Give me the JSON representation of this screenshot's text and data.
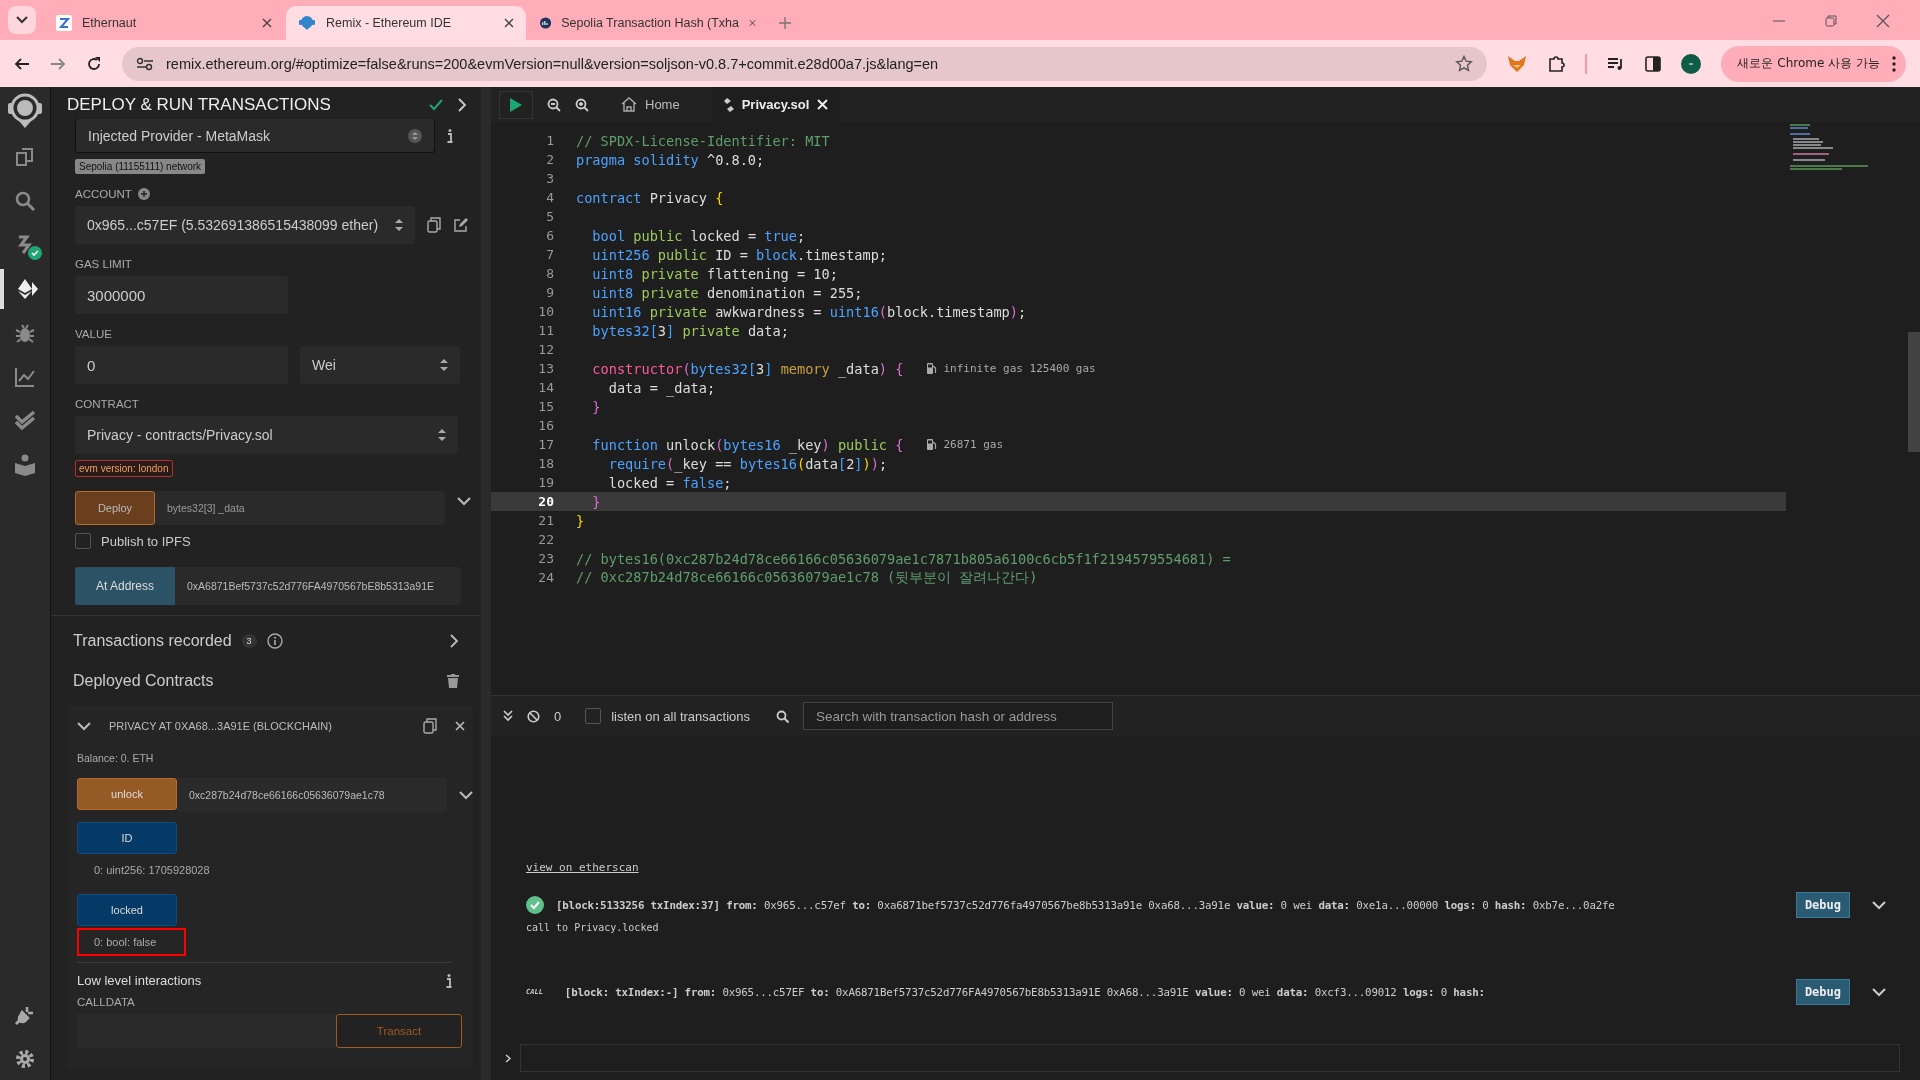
{
  "browser": {
    "tabs": [
      {
        "title": "Ethernaut",
        "kind": "z",
        "selected": false
      },
      {
        "title": "Remix - Ethereum IDE",
        "kind": "remix",
        "selected": true
      },
      {
        "title": "Sepolia Transaction Hash (Txha",
        "kind": "scan",
        "selected": false
      }
    ],
    "address": "remix.ethereum.org/#optimize=false&runs=200&evmVersion=null&version=soljson-v0.8.7+commit.e28d00a7.js&lang=en",
    "update_button": "새로운 Chrome 사용 가능"
  },
  "icon_bar": [
    {
      "kind": "files",
      "selected": false,
      "badge": false
    },
    {
      "kind": "search",
      "selected": false,
      "badge": false
    },
    {
      "kind": "compiler",
      "selected": false,
      "badge": true
    },
    {
      "kind": "deploy",
      "selected": true,
      "badge": false
    },
    {
      "kind": "debug",
      "selected": false,
      "badge": false
    },
    {
      "kind": "chart",
      "selected": false,
      "badge": false
    },
    {
      "kind": "tests",
      "selected": false,
      "badge": false
    },
    {
      "kind": "learn",
      "selected": false,
      "badge": false
    }
  ],
  "panel": {
    "title": "DEPLOY & RUN TRANSACTIONS",
    "environment": "Injected Provider - MetaMask",
    "network": "Sepolia (11155111) network",
    "account_label": "ACCOUNT",
    "account": "0x965...c57EF (5.532691386515438099 ether)",
    "gas_limit_label": "GAS LIMIT",
    "gas_limit": "3000000",
    "value_label": "VALUE",
    "value": "0",
    "unit": "Wei",
    "contract_label": "CONTRACT",
    "contract": "Privacy - contracts/Privacy.sol",
    "evm_badge": "evm version: london",
    "deploy_button": "Deploy",
    "deploy_placeholder": "bytes32[3] _data",
    "publish": {
      "label": "Publish to IPFS",
      "checked": false
    },
    "at_address_button": "At Address",
    "at_address_value": "0xA6871Bef5737c52d776FA4970567bE8b5313a91E",
    "recorded": {
      "label": "Transactions recorded",
      "count": "3"
    },
    "deployed_title": "Deployed Contracts",
    "instance": {
      "title": "PRIVACY AT 0XA68...3A91E (BLOCKCHAIN)",
      "expanded": true,
      "balance": "Balance: 0. ETH",
      "functions": [
        {
          "kind": "transact",
          "name": "unlock",
          "value": "0xc287b24d78ce66166c05636079ae1c78",
          "highlighted": false
        },
        {
          "kind": "call",
          "name": "ID",
          "output": "0: uint256: 1705928028",
          "highlighted": false
        },
        {
          "kind": "call",
          "name": "locked",
          "output": "0: bool: false",
          "highlighted": true
        }
      ],
      "low_level": {
        "title": "Low level interactions",
        "calldata_label": "CALLDATA",
        "button": "Transact"
      }
    }
  },
  "editor": {
    "tabs": [
      {
        "label": "Home",
        "kind": "home",
        "selected": false
      },
      {
        "label": "Privacy.sol",
        "kind": "file",
        "selected": true
      }
    ],
    "lines": [
      {
        "number": "1",
        "selected": false,
        "tokens": [
          {
            "text": "// SPDX-License-Identifier: MIT",
            "kind": "comment"
          }
        ]
      },
      {
        "number": "2",
        "selected": false,
        "tokens": [
          {
            "text": "pragma solidity",
            "kind": "keyword"
          },
          {
            "text": " ^0.8.0;",
            "kind": "plain"
          }
        ]
      },
      {
        "number": "3",
        "selected": false
      },
      {
        "number": "4",
        "selected": false,
        "tokens": [
          {
            "text": "contract",
            "kind": "keyword"
          },
          {
            "text": " Privacy ",
            "kind": "plain"
          },
          {
            "text": "{",
            "kind": "brace1"
          }
        ]
      },
      {
        "number": "5",
        "selected": false
      },
      {
        "number": "6",
        "selected": false,
        "tokens": [
          {
            "text": "  bool",
            "kind": "keyword"
          },
          {
            "text": " public",
            "kind": "modifier"
          },
          {
            "text": " locked = ",
            "kind": "plain"
          },
          {
            "text": "true",
            "kind": "keyword"
          },
          {
            "text": ";",
            "kind": "plain"
          }
        ]
      },
      {
        "number": "7",
        "selected": false,
        "tokens": [
          {
            "text": "  uint256",
            "kind": "keyword"
          },
          {
            "text": " public",
            "kind": "modifier"
          },
          {
            "text": " ID = ",
            "kind": "plain"
          },
          {
            "text": "block",
            "kind": "keyword"
          },
          {
            "text": ".timestamp;",
            "kind": "plain"
          }
        ]
      },
      {
        "number": "8",
        "selected": false,
        "tokens": [
          {
            "text": "  uint8",
            "kind": "keyword"
          },
          {
            "text": " private",
            "kind": "modifier"
          },
          {
            "text": " flattening = 10;",
            "kind": "plain"
          }
        ]
      },
      {
        "number": "9",
        "selected": false,
        "tokens": [
          {
            "text": "  uint8",
            "kind": "keyword"
          },
          {
            "text": " private",
            "kind": "modifier"
          },
          {
            "text": " denomination = 255;",
            "kind": "plain"
          }
        ]
      },
      {
        "number": "10",
        "selected": false,
        "tokens": [
          {
            "text": "  uint16",
            "kind": "keyword"
          },
          {
            "text": " private",
            "kind": "modifier"
          },
          {
            "text": " awkwardness = ",
            "kind": "plain"
          },
          {
            "text": "uint16",
            "kind": "keyword"
          },
          {
            "text": "(",
            "kind": "paren"
          },
          {
            "text": "block.timestamp",
            "kind": "plain"
          },
          {
            "text": ")",
            "kind": "paren"
          },
          {
            "text": ";",
            "kind": "plain"
          }
        ]
      },
      {
        "number": "11",
        "selected": false,
        "tokens": [
          {
            "text": "  bytes32",
            "kind": "keyword"
          },
          {
            "text": "[",
            "kind": "bracket"
          },
          {
            "text": "3",
            "kind": "plain"
          },
          {
            "text": "]",
            "kind": "bracket"
          },
          {
            "text": " private",
            "kind": "modifier"
          },
          {
            "text": " data;",
            "kind": "plain"
          }
        ]
      },
      {
        "number": "12",
        "selected": false
      },
      {
        "number": "13",
        "selected": false,
        "gas": "infinite gas 125400 gas",
        "tokens": [
          {
            "text": "  constructor",
            "kind": "special"
          },
          {
            "text": "(",
            "kind": "paren"
          },
          {
            "text": "bytes32",
            "kind": "keyword"
          },
          {
            "text": "[",
            "kind": "bracket"
          },
          {
            "text": "3",
            "kind": "plain"
          },
          {
            "text": "]",
            "kind": "bracket"
          },
          {
            "text": " memory",
            "kind": "storage"
          },
          {
            "text": " _data",
            "kind": "plain"
          },
          {
            "text": ")",
            "kind": "paren"
          },
          {
            "text": " {",
            "kind": "brace2"
          }
        ]
      },
      {
        "number": "14",
        "selected": false,
        "tokens": [
          {
            "text": "    data = _data;",
            "kind": "plain"
          }
        ]
      },
      {
        "number": "15",
        "selected": false,
        "tokens": [
          {
            "text": "  }",
            "kind": "brace2"
          }
        ]
      },
      {
        "number": "16",
        "selected": false
      },
      {
        "number": "17",
        "selected": false,
        "gas": "26871 gas",
        "tokens": [
          {
            "text": "  function",
            "kind": "keyword"
          },
          {
            "text": " unlock",
            "kind": "plain"
          },
          {
            "text": "(",
            "kind": "paren"
          },
          {
            "text": "bytes16",
            "kind": "keyword"
          },
          {
            "text": " _key",
            "kind": "plain"
          },
          {
            "text": ")",
            "kind": "paren"
          },
          {
            "text": " public",
            "kind": "modifier"
          },
          {
            "text": " {",
            "kind": "brace2"
          }
        ]
      },
      {
        "number": "18",
        "selected": false,
        "tokens": [
          {
            "text": "    require",
            "kind": "keyword"
          },
          {
            "text": "(",
            "kind": "paren"
          },
          {
            "text": "_key == ",
            "kind": "plain"
          },
          {
            "text": "bytes16",
            "kind": "keyword"
          },
          {
            "text": "(",
            "kind": "brace1"
          },
          {
            "text": "data",
            "kind": "plain"
          },
          {
            "text": "[",
            "kind": "bracket"
          },
          {
            "text": "2",
            "kind": "plain"
          },
          {
            "text": "]",
            "kind": "bracket"
          },
          {
            "text": ")",
            "kind": "brace1"
          },
          {
            "text": ")",
            "kind": "paren"
          },
          {
            "text": ";",
            "kind": "plain"
          }
        ]
      },
      {
        "number": "19",
        "selected": false,
        "tokens": [
          {
            "text": "    locked = ",
            "kind": "plain"
          },
          {
            "text": "false",
            "kind": "keyword"
          },
          {
            "text": ";",
            "kind": "plain"
          }
        ]
      },
      {
        "number": "20",
        "selected": true,
        "tokens": [
          {
            "text": "  }",
            "kind": "brace2"
          }
        ]
      },
      {
        "number": "21",
        "selected": false,
        "tokens": [
          {
            "text": "}",
            "kind": "brace1"
          }
        ]
      },
      {
        "number": "22",
        "selected": false
      },
      {
        "number": "23",
        "selected": false,
        "tokens": [
          {
            "text": "// bytes16(0xc287b24d78ce66166c05636079ae1c7871b805a6100c6cb5f1f2194579554681) =",
            "kind": "comment"
          }
        ]
      },
      {
        "number": "24",
        "selected": false,
        "tokens": [
          {
            "text": "// 0xc287b24d78ce66166c05636079ae1c78 (뒷부분이 잘려나간다)",
            "kind": "comment"
          }
        ]
      }
    ]
  },
  "terminal": {
    "pending_count": "0",
    "listen": {
      "label": "listen on all transactions",
      "checked": false
    },
    "search_placeholder": "Search with transaction hash or address",
    "link": "view on etherscan",
    "entries": [
      {
        "kind": "success",
        "text": "**[block:5133256 txIndex:37]** **from:** 0x965...c57ef **to:** 0xa6871bef5737c52d776fa4970567be8b5313a91e 0xa68...3a91e **value:** 0 wei **data:** 0xe1a...00000 **logs:** 0 **hash:** 0xb7e...0a2fe",
        "note": "call to Privacy.locked",
        "button": "Debug"
      },
      {
        "kind": "call",
        "badge": "CALL",
        "text": "**[block: txIndex:-]** **from:** 0x965...c57EF **to:** 0xA6871Bef5737c52d776FA4970567bE8b5313a91E 0xA68...3a91E **value:** 0 wei **data:** 0xcf3...09012 **logs:** 0 **hash:**",
        "button": "Debug"
      }
    ]
  }
}
